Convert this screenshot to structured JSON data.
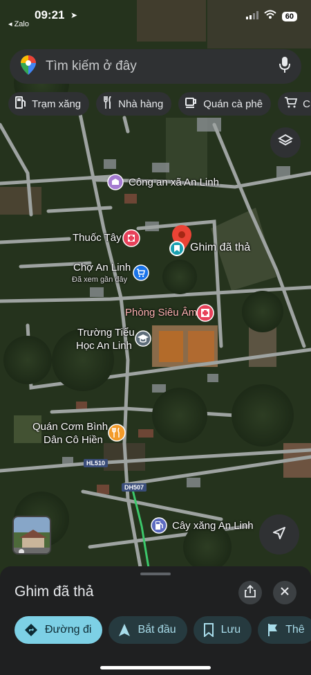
{
  "status_bar": {
    "time": "09:21",
    "back_app": "Zalo",
    "battery": "60"
  },
  "search": {
    "placeholder": "Tìm kiếm ở đây"
  },
  "chips": [
    {
      "label": "Trạm xăng",
      "icon": "gas-station-icon"
    },
    {
      "label": "Nhà hàng",
      "icon": "restaurant-icon"
    },
    {
      "label": "Quán cà phê",
      "icon": "coffee-icon"
    },
    {
      "label": "Cử",
      "icon": "cart-icon"
    }
  ],
  "map_labels": {
    "police": "Công an xã An Linh",
    "pharmacy": "Thuốc Tây",
    "dropped_pin": "Ghim đã thả",
    "market": "Chợ An Linh",
    "market_sub": "Đã xem gần đây",
    "ultrasound": "Phòng Siêu Âm",
    "school_line1": "Trường Tiểu",
    "school_line2": "Học An Linh",
    "restaurant_line1": "Quán Cơm Bình",
    "restaurant_line2": "Dân Cô Hiền",
    "gas": "Cây xăng An Linh",
    "road_hl510": "HL510",
    "road_dh507": "DH507"
  },
  "sheet": {
    "title": "Ghim đã thả",
    "actions": [
      {
        "label": "Đường đi",
        "icon": "directions-icon",
        "primary": true
      },
      {
        "label": "Bắt đầu",
        "icon": "navigation-arrow-icon",
        "primary": false
      },
      {
        "label": "Lưu",
        "icon": "bookmark-icon",
        "primary": false
      },
      {
        "label": "Thê",
        "icon": "flag-icon",
        "primary": false
      }
    ]
  },
  "colors": {
    "accent": "#7dd0e5",
    "pin": "#ea4335",
    "chip_bg": "#2f3133",
    "sheet_bg": "#1f2021"
  }
}
